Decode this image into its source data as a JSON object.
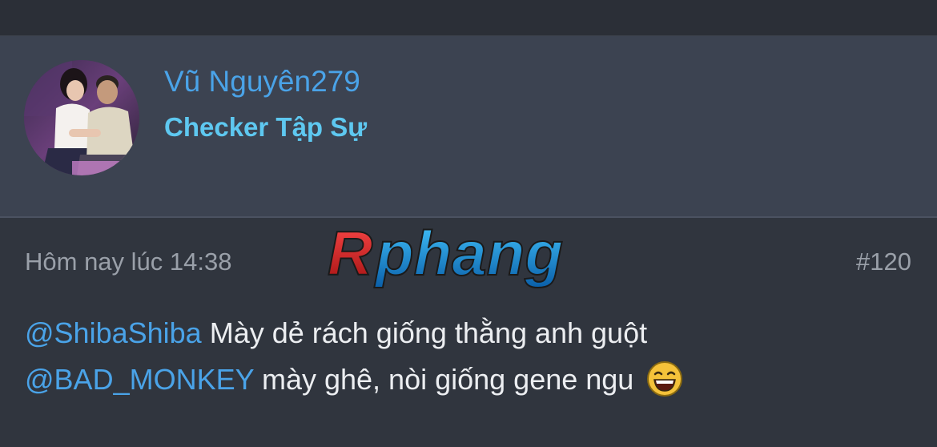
{
  "user": {
    "name": "Vũ Nguyên279",
    "title": "Checker Tập Sự"
  },
  "watermark": {
    "text": "Rphang"
  },
  "post": {
    "timestamp": "Hôm nay lúc 14:38",
    "number": "#120",
    "lines": [
      {
        "mention": "@ShibaShiba",
        "text": " Mày dẻ rách giống thằng anh guột"
      },
      {
        "mention": "@BAD_MONKEY",
        "text": " mày ghê, nòi giống gene ngu"
      }
    ],
    "emoji": "laughing-face"
  },
  "colors": {
    "background": "#2b2f37",
    "user_block": "#3c4351",
    "username": "#4aa3e8",
    "user_title": "#5ec8f0",
    "mention": "#4aa3e8",
    "meta": "#9aa0a9",
    "body_text": "#eceef1"
  }
}
